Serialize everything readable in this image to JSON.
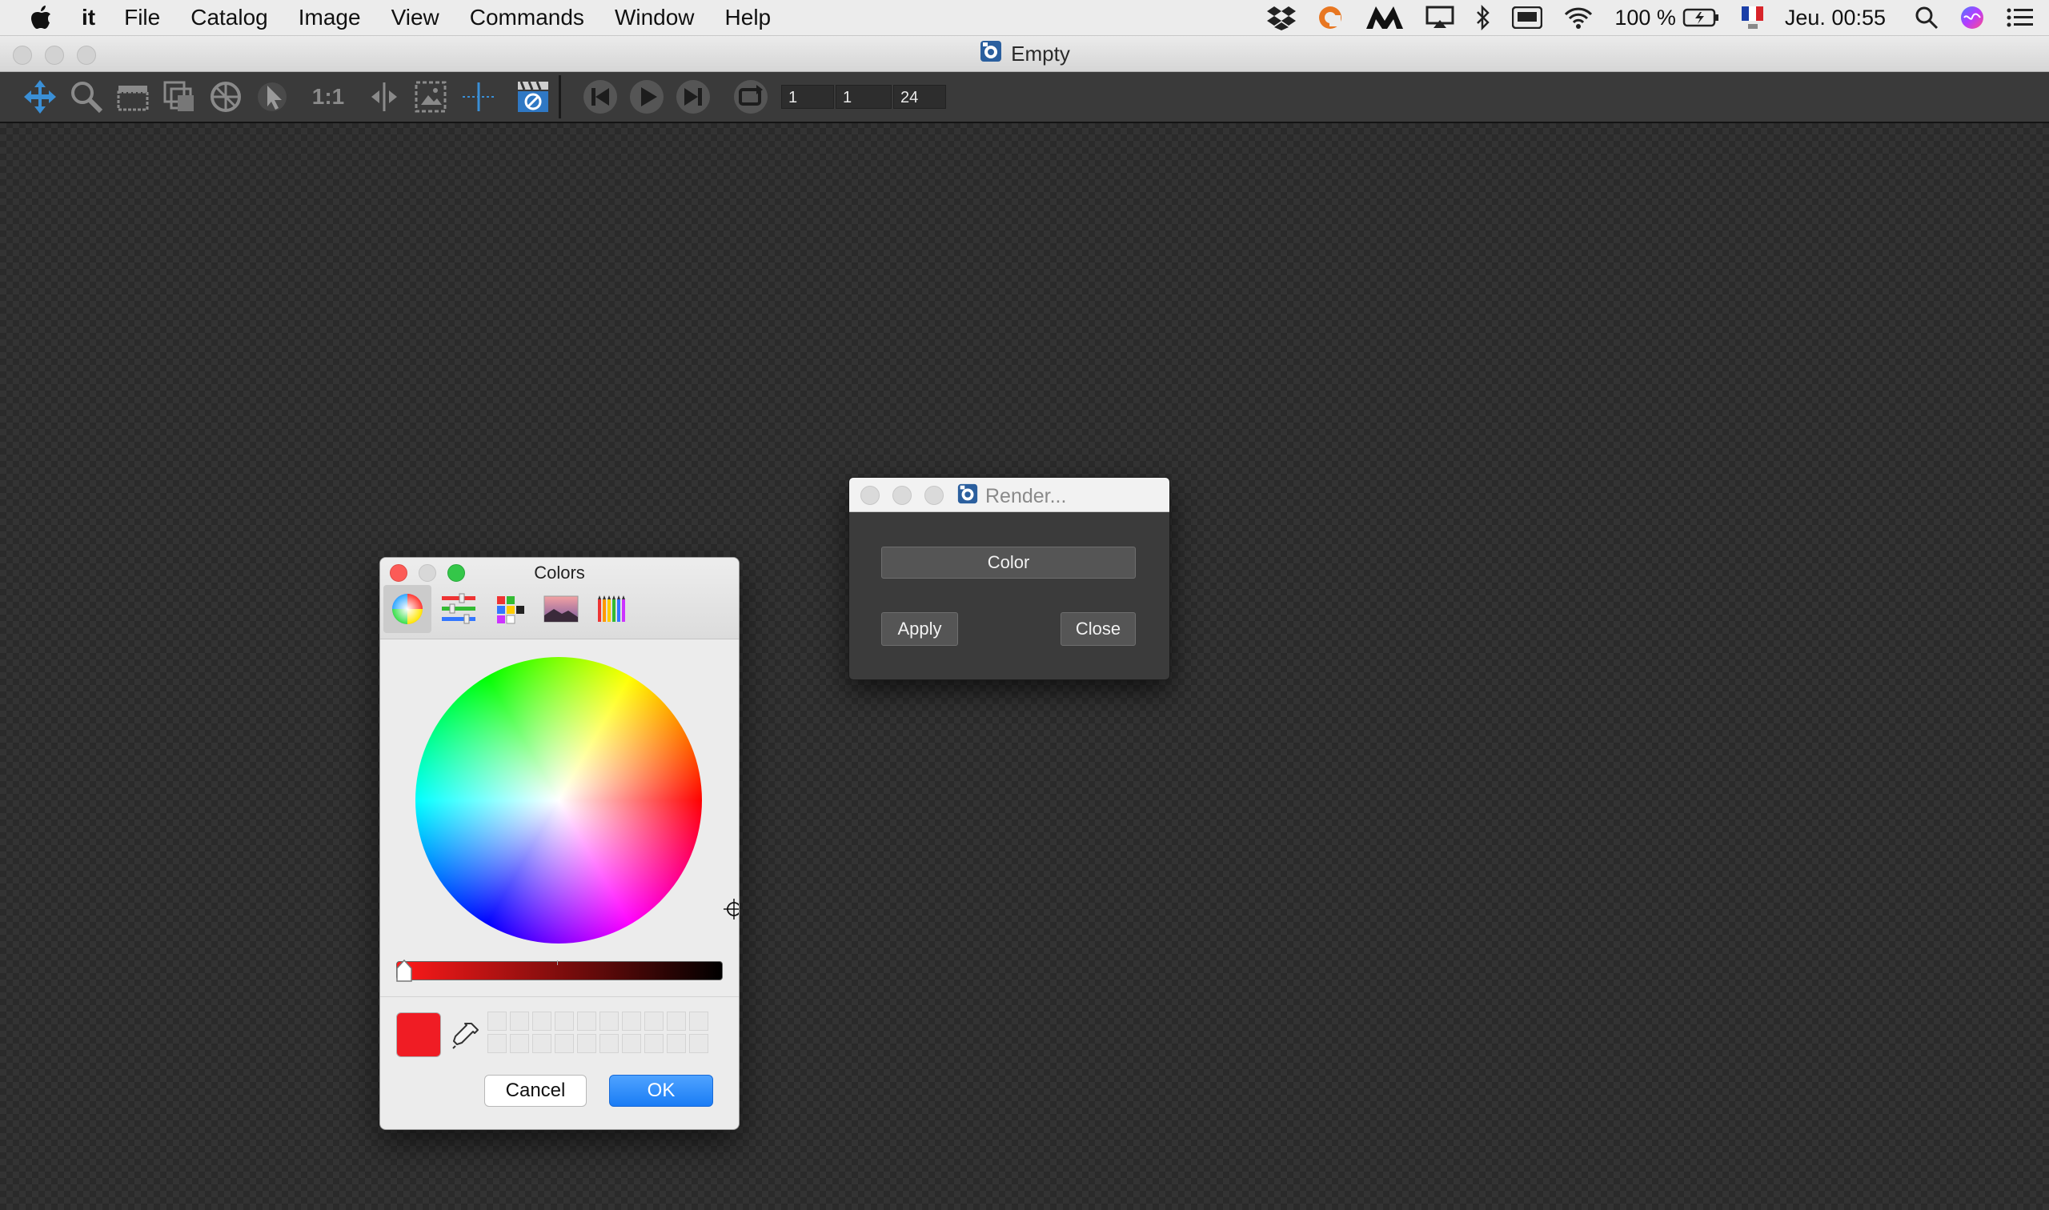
{
  "menubar": {
    "app_name": "it",
    "items": [
      "File",
      "Catalog",
      "Image",
      "View",
      "Commands",
      "Window",
      "Help"
    ],
    "status": {
      "battery_percent": "100 %",
      "clock": "Jeu. 00:55",
      "icons": [
        "dropbox-icon",
        "sync-icon",
        "m-app-icon",
        "airplay-icon",
        "bluetooth-icon",
        "keyboard-icon",
        "wifi-icon",
        "battery-icon",
        "french-flag-input-icon",
        "spotlight-icon",
        "siri-icon",
        "notification-center-icon"
      ]
    }
  },
  "main_window": {
    "title": "Empty",
    "toolbar": {
      "tools": [
        "move-tool-icon",
        "zoom-tool-icon",
        "film-clapper-icon",
        "layers-icon",
        "color-picker-wheel-icon",
        "select-arrow-icon",
        "one-to-one-icon",
        "split-compare-icon",
        "image-frame-icon",
        "guide-icon",
        "clapper-blocked-icon"
      ],
      "one_to_one_label": "1:1",
      "playback": [
        "skip-start-icon",
        "play-icon",
        "skip-end-icon",
        "loop-icon"
      ],
      "frame_start": "1",
      "frame_current": "1",
      "frame_end": "24"
    }
  },
  "colors_panel": {
    "title": "Colors",
    "tabs": [
      "color-wheel-tab",
      "sliders-tab",
      "palettes-tab",
      "image-palettes-tab",
      "pencils-tab"
    ],
    "selected_tab": "color-wheel-tab",
    "current_color": "#f01c24",
    "cancel_label": "Cancel",
    "ok_label": "OK",
    "brightness_level": 1.0
  },
  "render_dialog": {
    "title": "Render...",
    "color_button": "Color",
    "apply_button": "Apply",
    "close_button": "Close"
  }
}
